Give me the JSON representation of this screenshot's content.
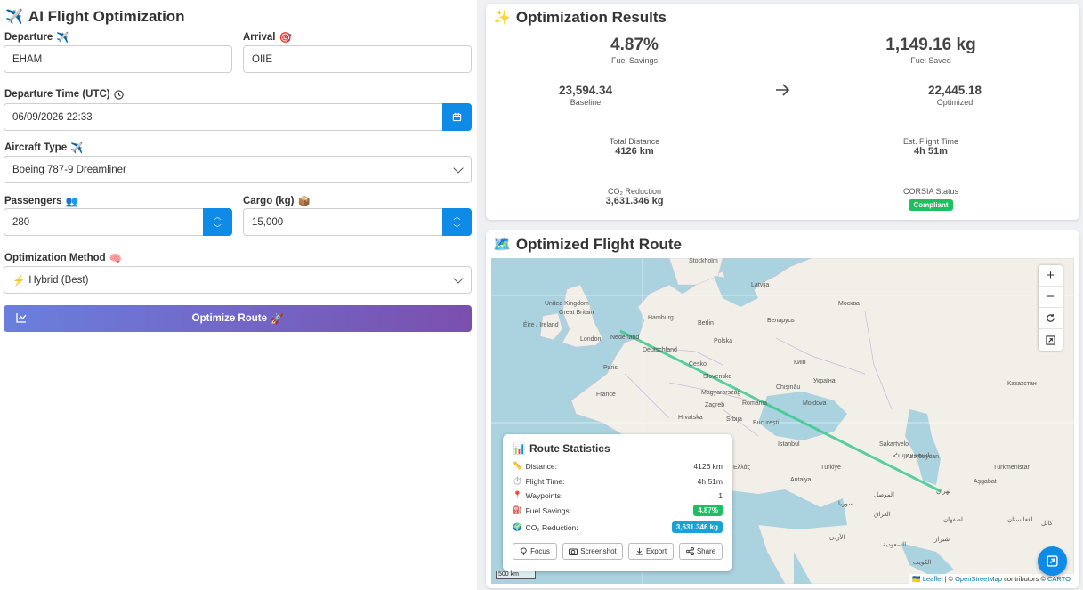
{
  "form": {
    "title": "AI Flight Optimization",
    "departure_label": "Departure",
    "departure_value": "EHAM",
    "arrival_label": "Arrival",
    "arrival_value": "OIIE",
    "time_label": "Departure Time (UTC)",
    "time_value": "06/09/2026 22:33",
    "aircraft_label": "Aircraft Type",
    "aircraft_value": "Boeing 787-9 Dreamliner",
    "passengers_label": "Passengers",
    "passengers_value": "280",
    "cargo_label": "Cargo (kg)",
    "cargo_value": "15,000",
    "method_label": "Optimization Method",
    "method_value": "Hybrid (Best)",
    "optimize_label": "Optimize Route"
  },
  "results": {
    "title": "Optimization Results",
    "fuel_savings_pct": "4.87%",
    "fuel_savings_label": "Fuel Savings",
    "fuel_saved": "1,149.16 kg",
    "fuel_saved_label": "Fuel Saved",
    "baseline": "23,594.34",
    "baseline_label": "Baseline",
    "optimized": "22,445.18",
    "optimized_label": "Optimized",
    "distance_label": "Total Distance",
    "distance": "4126 km",
    "flight_time_label": "Est. Flight Time",
    "flight_time": "4h 51m",
    "co2_label": "CO₂ Reduction",
    "co2": "3,631.346 kg",
    "corsia_label": "CORSIA Status",
    "corsia": "Compliant"
  },
  "map": {
    "title": "Optimized Flight Route",
    "labels": [
      "Stockholm",
      "Latvija",
      "United Kingdom",
      "Great Britain",
      "Éire / Ireland",
      "Hamburg",
      "Berlin",
      "Nederland",
      "London",
      "Deutschland",
      "Polska",
      "Беларусь",
      "Москва",
      "Paris",
      "France",
      "Česko",
      "Slovensko",
      "Київ",
      "Україна",
      "Magyarország",
      "Chișinău",
      "Zagreb",
      "România",
      "Hrvatska",
      "București",
      "Srbija",
      "Казахстан",
      "İstanbul",
      "Ελλάς",
      "Türkiye",
      "Azərbaycan",
      "Türkmenistan",
      "Aşgabat",
      "Antalya",
      "الموصل",
      "العراق",
      "سوريا",
      "الأردن",
      "الكويت",
      "السعودية",
      "تهران",
      "اصفهان",
      "شيراز",
      "افغانستان",
      "کابل",
      "Moldova",
      "Sakartvelo",
      "Հայաստան"
    ],
    "scale": "500 km",
    "attribution_leaflet": "Leaflet",
    "attribution_osm": "OpenStreetMap",
    "attribution_mid": "contributors ©",
    "attribution_carto": "CARTO",
    "route_color": "#3cc88e"
  },
  "stats": {
    "title": "Route Statistics",
    "distance_label": "Distance:",
    "distance": "4126 km",
    "time_label": "Flight Time:",
    "time": "4h 51m",
    "waypoints_label": "Waypoints:",
    "waypoints": "1",
    "fuel_label": "Fuel Savings:",
    "fuel": "4.87%",
    "co2_label": "CO₂ Reduction:",
    "co2": "3,631.346 kg",
    "focus": "Focus",
    "screenshot": "Screenshot",
    "export": "Export",
    "share": "Share"
  }
}
